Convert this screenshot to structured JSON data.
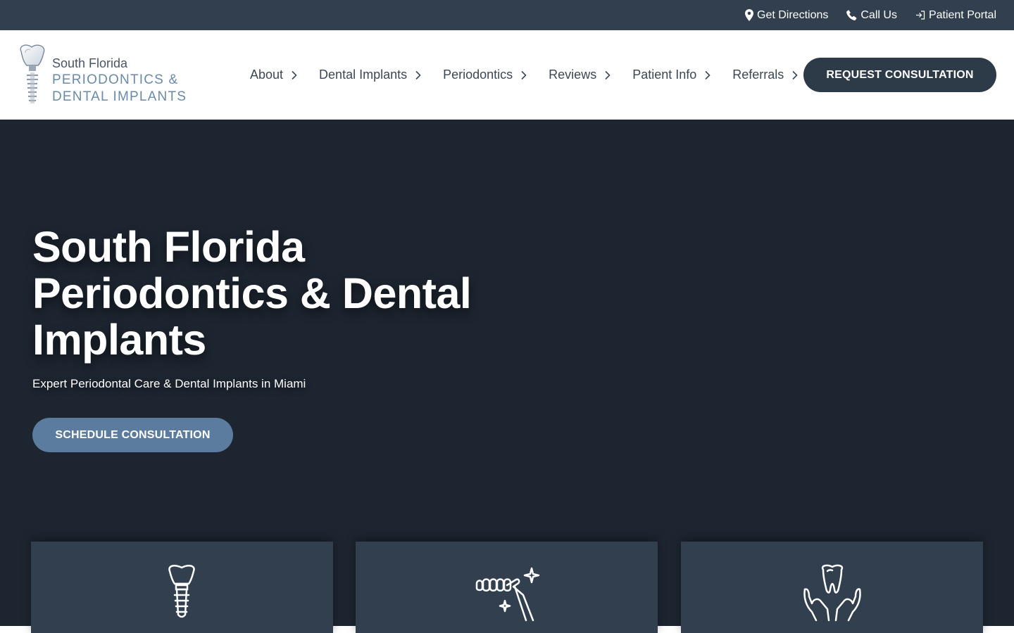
{
  "topbar": {
    "links": [
      {
        "label": "Get Directions",
        "icon": "map-pin-icon"
      },
      {
        "label": "Call Us",
        "icon": "phone-icon"
      },
      {
        "label": "Patient Portal",
        "icon": "sign-in-icon"
      }
    ]
  },
  "logo": {
    "line1": "South Florida",
    "line2": "PERIODONTICS &",
    "line3": "DENTAL IMPLANTS",
    "icon": "dental-implant-logo-icon"
  },
  "nav": {
    "items": [
      {
        "label": "About"
      },
      {
        "label": "Dental Implants"
      },
      {
        "label": "Periodontics"
      },
      {
        "label": "Reviews"
      },
      {
        "label": "Patient Info"
      },
      {
        "label": "Referrals"
      }
    ],
    "cta_label": "REQUEST CONSULTATION"
  },
  "hero": {
    "title": "South Florida Periodontics & Dental Implants",
    "subtitle": "Expert Periodontal Care & Dental Implants in Miami",
    "cta_label": "SCHEDULE CONSULTATION"
  },
  "cards": [
    {
      "icon": "dental-implant-icon"
    },
    {
      "icon": "teeth-cleaning-icon"
    },
    {
      "icon": "hands-tooth-care-icon"
    }
  ],
  "colors": {
    "topbar_bg": "#323f4e",
    "hero_bg": "#1d2530",
    "primary_button": "#2d3a48",
    "accent_button": "#5b7c9e",
    "card_bg": "#323f4e",
    "logo_accent": "#6b8aa8"
  }
}
